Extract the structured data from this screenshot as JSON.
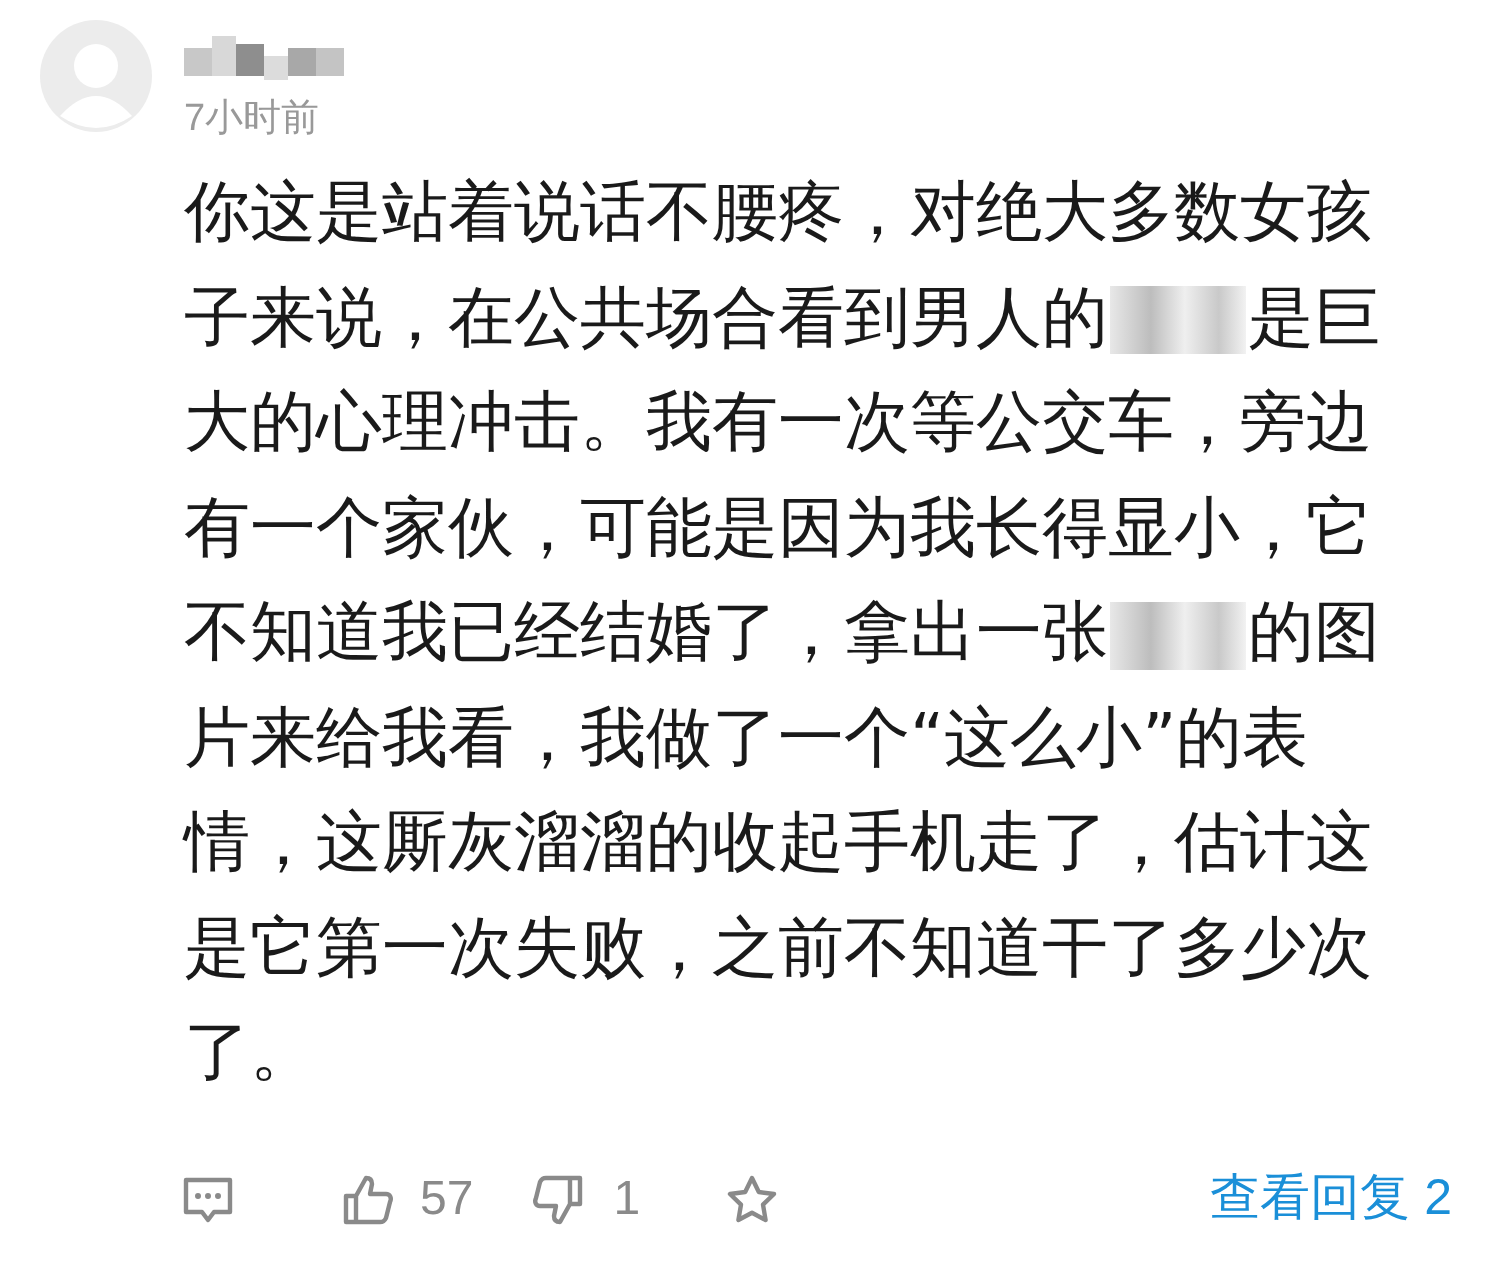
{
  "comment": {
    "time": "7小时前",
    "lines": [
      [
        {
          "kind": "text",
          "text": "你这是站着说话不腰疼，对绝大多数女孩"
        }
      ],
      [
        {
          "kind": "text",
          "text": "子来说，在公共场合看到男人的"
        },
        {
          "kind": "blurred"
        },
        {
          "kind": "text",
          "text": "是巨"
        }
      ],
      [
        {
          "kind": "text",
          "text": "大的心理冲击。我有一次等公交车，旁边"
        }
      ],
      [
        {
          "kind": "text",
          "text": "有一个家伙，可能是因为我长得显小，它"
        }
      ],
      [
        {
          "kind": "text",
          "text": "不知道我已经结婚了，拿出一张"
        },
        {
          "kind": "blurred"
        },
        {
          "kind": "text",
          "text": "的图"
        }
      ],
      [
        {
          "kind": "text",
          "text": "片来给我看，我做了一个“这么小”的表"
        }
      ],
      [
        {
          "kind": "text",
          "text": "情，这厮灰溜溜的收起手机走了，估计这"
        }
      ],
      [
        {
          "kind": "text",
          "text": "是它第一次失败，之前不知道干了多少次"
        }
      ],
      [
        {
          "kind": "text",
          "text": "了。"
        }
      ]
    ]
  },
  "actions": {
    "likes": "57",
    "dislikes": "1",
    "replies_link": "查看回复 2"
  }
}
